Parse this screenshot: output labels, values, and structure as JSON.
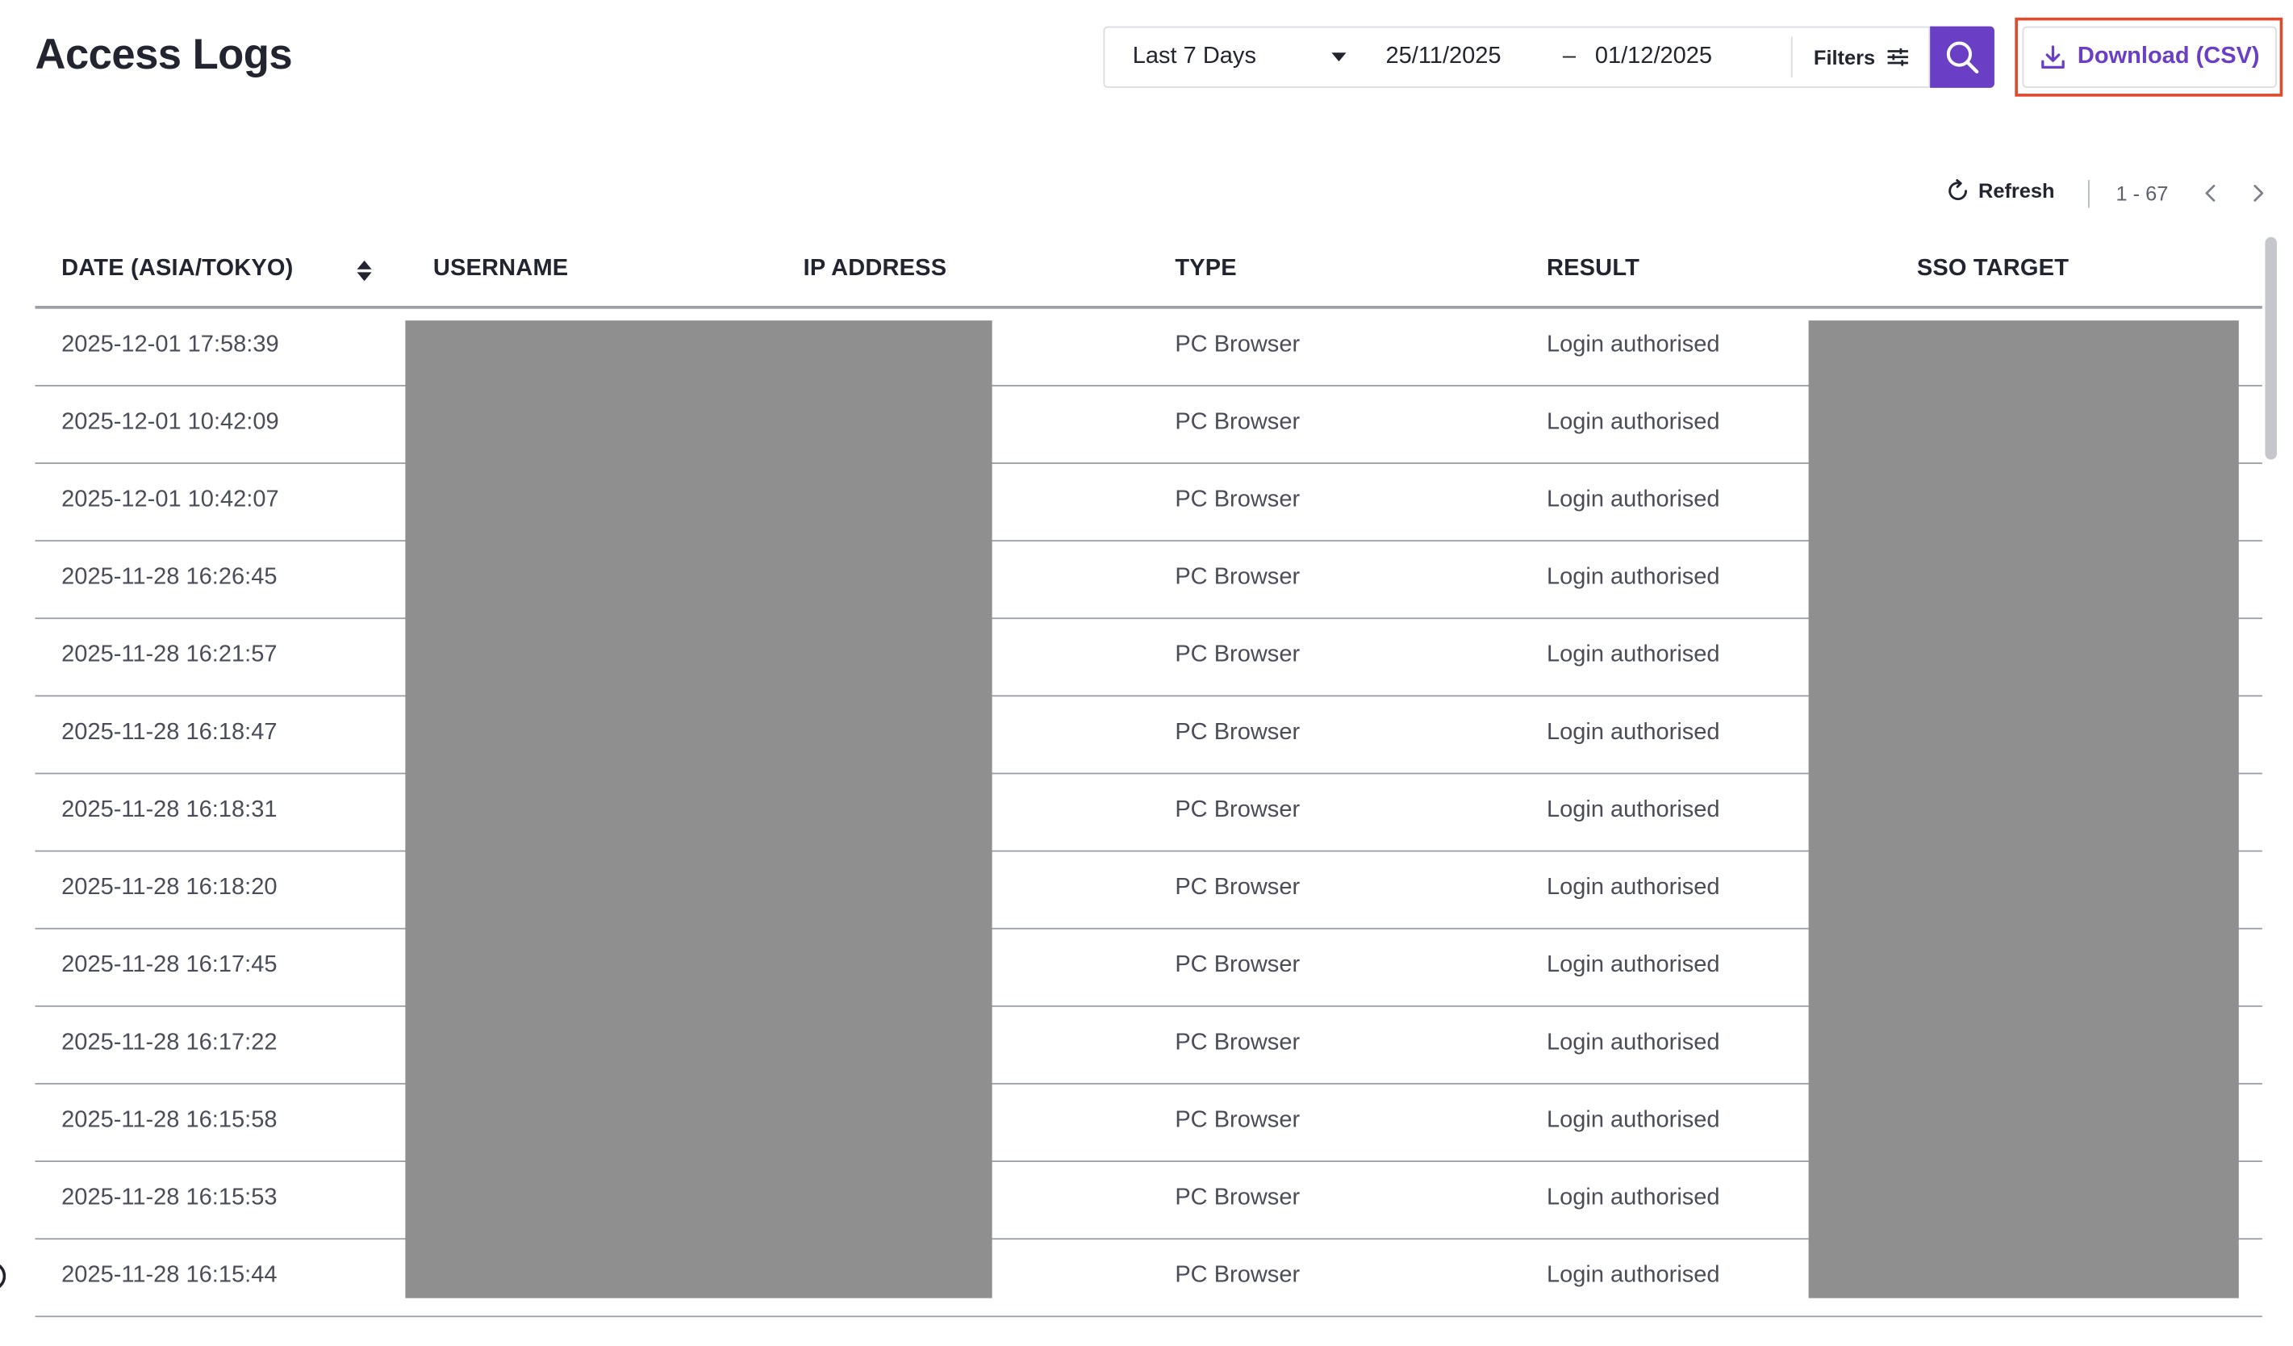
{
  "page": {
    "title": "Access Logs"
  },
  "toolbar": {
    "range_label": "Last 7 Days",
    "date_from": "25/11/2025",
    "date_separator": "–",
    "date_to": "01/12/2025",
    "filters_label": "Filters",
    "download_label": "Download (CSV)",
    "accent_color": "#6a3fc6",
    "highlight_color": "#e04a2f"
  },
  "pager": {
    "refresh_label": "Refresh",
    "range": "1 - 67"
  },
  "table": {
    "headers": {
      "date": "DATE (ASIA/TOKYO)",
      "username": "USERNAME",
      "ip": "IP ADDRESS",
      "type": "TYPE",
      "result": "RESULT",
      "sso": "SSO TARGET"
    },
    "rows": [
      {
        "date": "2025-12-01 17:58:39",
        "type": "PC Browser",
        "result": "Login authorised"
      },
      {
        "date": "2025-12-01 10:42:09",
        "type": "PC Browser",
        "result": "Login authorised"
      },
      {
        "date": "2025-12-01 10:42:07",
        "type": "PC Browser",
        "result": "Login authorised"
      },
      {
        "date": "2025-11-28 16:26:45",
        "type": "PC Browser",
        "result": "Login authorised"
      },
      {
        "date": "2025-11-28 16:21:57",
        "type": "PC Browser",
        "result": "Login authorised"
      },
      {
        "date": "2025-11-28 16:18:47",
        "type": "PC Browser",
        "result": "Login authorised"
      },
      {
        "date": "2025-11-28 16:18:31",
        "type": "PC Browser",
        "result": "Login authorised"
      },
      {
        "date": "2025-11-28 16:18:20",
        "type": "PC Browser",
        "result": "Login authorised"
      },
      {
        "date": "2025-11-28 16:17:45",
        "type": "PC Browser",
        "result": "Login authorised"
      },
      {
        "date": "2025-11-28 16:17:22",
        "type": "PC Browser",
        "result": "Login authorised"
      },
      {
        "date": "2025-11-28 16:15:58",
        "type": "PC Browser",
        "result": "Login authorised"
      },
      {
        "date": "2025-11-28 16:15:53",
        "type": "PC Browser",
        "result": "Login authorised"
      },
      {
        "date": "2025-11-28 16:15:44",
        "type": "PC Browser",
        "result": "Login authorised"
      }
    ]
  }
}
